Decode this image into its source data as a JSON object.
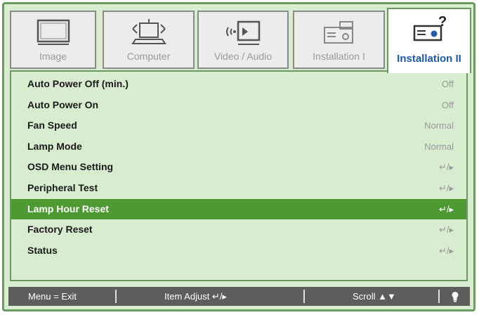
{
  "tabs": [
    {
      "label": "Image",
      "icon": "monitor-icon",
      "active": false
    },
    {
      "label": "Computer",
      "icon": "computer-icon",
      "active": false
    },
    {
      "label": "Video / Audio",
      "icon": "video-audio-icon",
      "active": false
    },
    {
      "label": "Installation I",
      "icon": "projector-icon",
      "active": false
    },
    {
      "label": "Installation II",
      "icon": "projector-help-icon",
      "active": true
    }
  ],
  "menu": {
    "items": [
      {
        "label": "Auto Power Off (min.)",
        "value": "Off"
      },
      {
        "label": "Auto Power On",
        "value": "Off"
      },
      {
        "label": "Fan Speed",
        "value": "Normal"
      },
      {
        "label": "Lamp Mode",
        "value": "Normal"
      },
      {
        "label": "OSD Menu Setting",
        "value": "↵/▸"
      },
      {
        "label": "Peripheral Test",
        "value": "↵/▸"
      },
      {
        "label": "Lamp Hour Reset",
        "value": "↵/▸"
      },
      {
        "label": "Factory Reset",
        "value": "↵/▸"
      },
      {
        "label": "Status",
        "value": "↵/▸"
      }
    ],
    "selected_index": 6
  },
  "statusbar": {
    "menu_exit": "Menu = Exit",
    "item_adjust": "Item Adjust ↵/▸",
    "scroll": "Scroll ▲▼",
    "info_icon": "lightbulb-icon"
  },
  "colors": {
    "background": "#d8ecd0",
    "selected_row": "#4e9a32",
    "active_tab_text": "#1e5aa8",
    "statusbar": "#5d5d5d"
  }
}
